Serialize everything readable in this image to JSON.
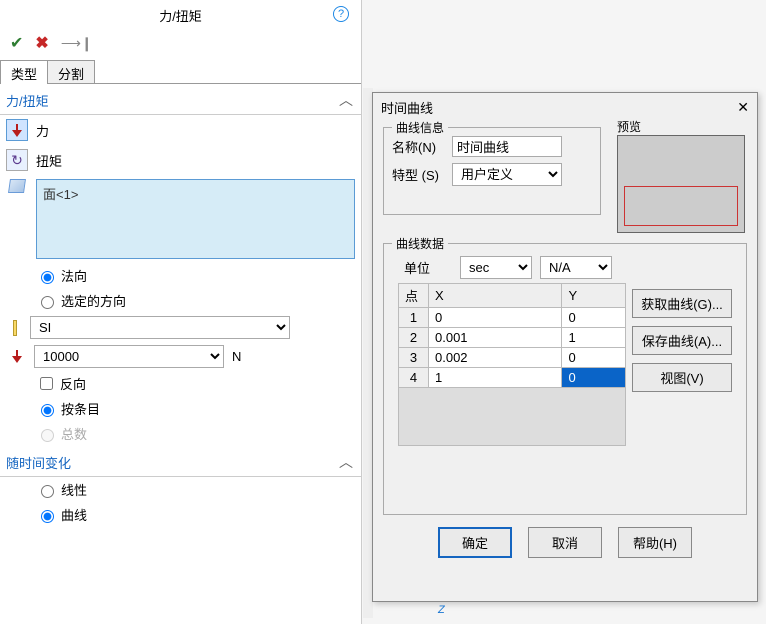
{
  "left": {
    "title": "力/扭矩",
    "tabs": {
      "type": "类型",
      "split": "分割"
    },
    "section_force": "力/扭矩",
    "force_label": "力",
    "torque_label": "扭矩",
    "selection_item": "面<1>",
    "dir_normal": "法向",
    "dir_selected": "选定的方向",
    "unit_system": "SI",
    "value": "10000",
    "value_unit": "N",
    "reverse": "反向",
    "per_item": "按条目",
    "total": "总数",
    "section_time": "随时间变化",
    "opt_linear": "线性",
    "opt_curve": "曲线"
  },
  "dialog": {
    "title": "时间曲线",
    "grp_info": "曲线信息",
    "name_lbl": "名称(N)",
    "name_val": "时间曲线",
    "type_lbl": "特型 (S)",
    "type_val": "用户定义",
    "preview_lbl": "预览",
    "grp_data": "曲线数据",
    "units_lbl": "单位",
    "unit_x": "sec",
    "unit_y": "N/A",
    "col_pt": "点",
    "col_x": "X",
    "col_y": "Y",
    "btn_get": "获取曲线(G)...",
    "btn_save": "保存曲线(A)...",
    "btn_view": "视图(V)",
    "btn_ok": "确定",
    "btn_cancel": "取消",
    "btn_help": "帮助(H)"
  },
  "chart_data": {
    "type": "table",
    "columns": [
      "点",
      "X",
      "Y"
    ],
    "x_unit": "sec",
    "y_unit": "N/A",
    "rows": [
      {
        "pt": "1",
        "x": "0",
        "y": "0"
      },
      {
        "pt": "2",
        "x": "0.001",
        "y": "1"
      },
      {
        "pt": "3",
        "x": "0.002",
        "y": "0"
      },
      {
        "pt": "4",
        "x": "1",
        "y": "0"
      }
    ],
    "selected_row": 3
  }
}
